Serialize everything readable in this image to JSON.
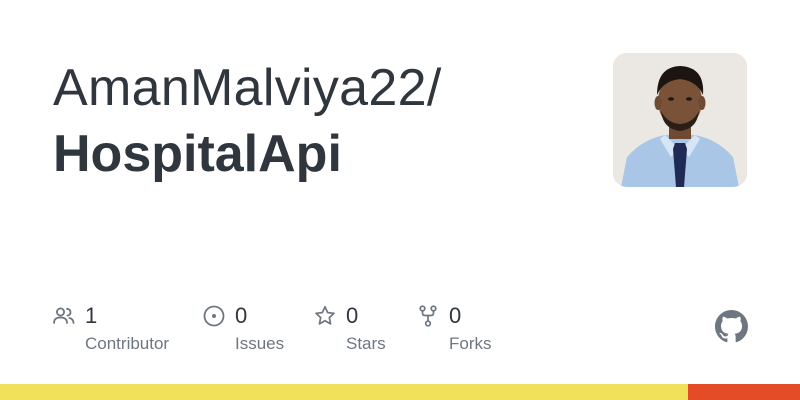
{
  "repo_card": {
    "owner": "AmanMalviya22/",
    "repo_name": "HospitalApi"
  },
  "stats": [
    {
      "icon": "people-icon",
      "value": "1",
      "label": "Contributor"
    },
    {
      "icon": "issue-opened-icon",
      "value": "0",
      "label": "Issues"
    },
    {
      "icon": "star-icon",
      "value": "0",
      "label": "Stars"
    },
    {
      "icon": "repo-forked-icon",
      "value": "0",
      "label": "Forks"
    }
  ],
  "language_bar": [
    {
      "color": "#f1e05a",
      "fraction": 0.86
    },
    {
      "color": "#e34c26",
      "fraction": 0.14
    }
  ],
  "colors": {
    "text": "#2f363d",
    "muted": "#6e7781",
    "icon": "#6e7781"
  }
}
